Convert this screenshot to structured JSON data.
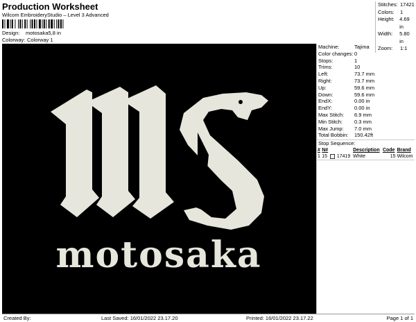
{
  "header": {
    "title": "Production Worksheet",
    "subtitle": "Wilcom EmbroideryStudio – Level 3 Advanced",
    "design_label": "Design:",
    "design_value": "motosaka5,8 in",
    "colorway_label": "Colorway:",
    "colorway_value": "Colorway 1"
  },
  "stats": {
    "stitches_label": "Stitches:",
    "stitches": "17421",
    "colors_label": "Colors:",
    "colors": "1",
    "height_label": "Height:",
    "height": "4.69 in",
    "width_label": "Width:",
    "width": "5.80 in",
    "zoom_label": "Zoom:",
    "zoom": "1:1"
  },
  "design": {
    "monogram": "ms",
    "wordmark": "motosaka",
    "thread_color": "#e6e6dc",
    "background_color": "#000000"
  },
  "machine": [
    {
      "label": "Machine:",
      "value": "Tajima"
    },
    {
      "label": "Color changes:",
      "value": "0"
    },
    {
      "label": "Stops:",
      "value": "1"
    },
    {
      "label": "Trims:",
      "value": "10"
    },
    {
      "label": "Left:",
      "value": "73.7 mm"
    },
    {
      "label": "Right:",
      "value": "73.7 mm"
    },
    {
      "label": "Up:",
      "value": "59.6 mm"
    },
    {
      "label": "Down:",
      "value": "59.6 mm"
    },
    {
      "label": "EndX:",
      "value": "0.00 in"
    },
    {
      "label": "EndY:",
      "value": "0.00 in"
    },
    {
      "label": "Max Stitch:",
      "value": "6.9 mm"
    },
    {
      "label": "Min Stitch:",
      "value": "0.3 mm"
    },
    {
      "label": "Max Jump:",
      "value": "7.0 mm"
    },
    {
      "label": "Total Bobbin:",
      "value": "150.42ft"
    }
  ],
  "stop_sequence": {
    "title": "Stop Sequence:",
    "columns": [
      "#",
      "N#",
      "",
      "Description",
      "Code",
      "Brand"
    ],
    "rows": [
      {
        "num": "1",
        "n": "15",
        "stitches": "17419",
        "description": "White",
        "code": "15",
        "brand": "Wilcom"
      }
    ]
  },
  "footer": {
    "created_by": "Created By:",
    "last_saved": "Last Saved: 16/01/2022 23.17.20",
    "printed": "Printed: 16/01/2022 23.17.22",
    "page": "Page 1 of 1"
  }
}
